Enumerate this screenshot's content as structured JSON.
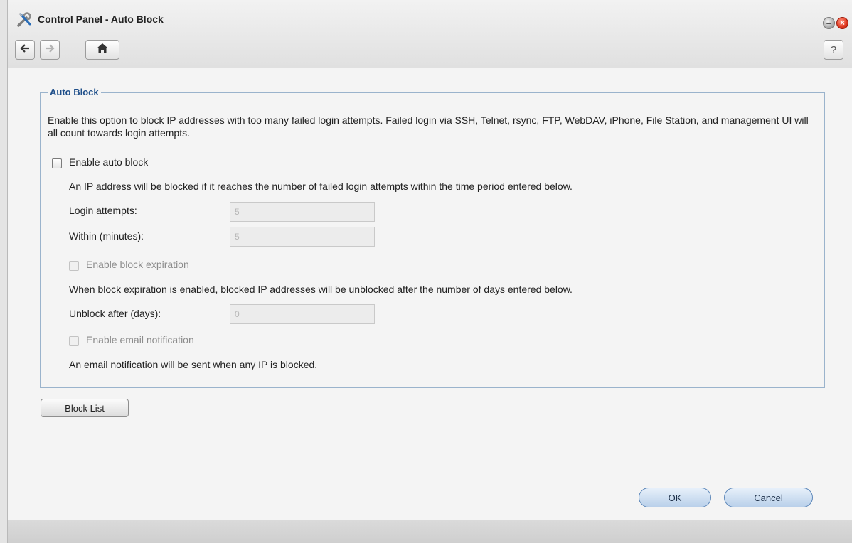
{
  "window": {
    "title": "Control Panel - Auto Block",
    "help_label": "?"
  },
  "icons": {
    "app": "tools-icon",
    "back": "back-arrow-icon",
    "forward": "forward-arrow-icon",
    "home": "home-icon",
    "minimize": "minimize-icon",
    "close": "close-icon",
    "help": "help-icon"
  },
  "auto_block": {
    "legend": "Auto Block",
    "description": "Enable this option to block IP addresses with too many failed login attempts. Failed login via SSH, Telnet, rsync, FTP, WebDAV, iPhone, File Station, and management UI will all count towards login attempts.",
    "enable_label": "Enable auto block",
    "enable_checked": false,
    "info_text": "An IP address will be blocked if it reaches the number of failed login attempts within the time period entered below.",
    "login_attempts_label": "Login attempts:",
    "login_attempts_value": "5",
    "within_label": "Within (minutes):",
    "within_value": "5",
    "expiration_label": "Enable block expiration",
    "expiration_checked": false,
    "expiration_info": "When block expiration is enabled, blocked IP addresses will be unblocked after the number of days entered below.",
    "unblock_label": "Unblock after (days):",
    "unblock_value": "0",
    "email_label": "Enable email notification",
    "email_checked": false,
    "email_info": "An email notification will be sent when any IP is blocked."
  },
  "buttons": {
    "block_list": "Block List",
    "ok": "OK",
    "cancel": "Cancel"
  },
  "colors": {
    "legend": "#1f4f8a",
    "group_border": "#9ab3cc",
    "close_button": "#e23b22"
  }
}
